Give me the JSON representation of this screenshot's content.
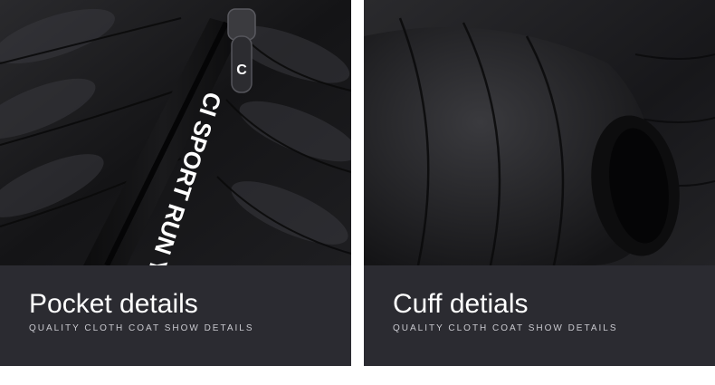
{
  "panels": [
    {
      "title": "Pocket details",
      "subtitle": "QUALITY CLOTH COAT SHOW DETAILS",
      "tape_text": "CI SPORT RUN YO",
      "tape_zip_letter": "C"
    },
    {
      "title": "Cuff detials",
      "subtitle": "QUALITY CLOTH COAT SHOW DETAILS"
    }
  ],
  "colors": {
    "jacket": "#1b1b1d",
    "caption_bg": "#2b2b31",
    "title": "#ffffff",
    "subtitle": "#c9c9cf"
  }
}
